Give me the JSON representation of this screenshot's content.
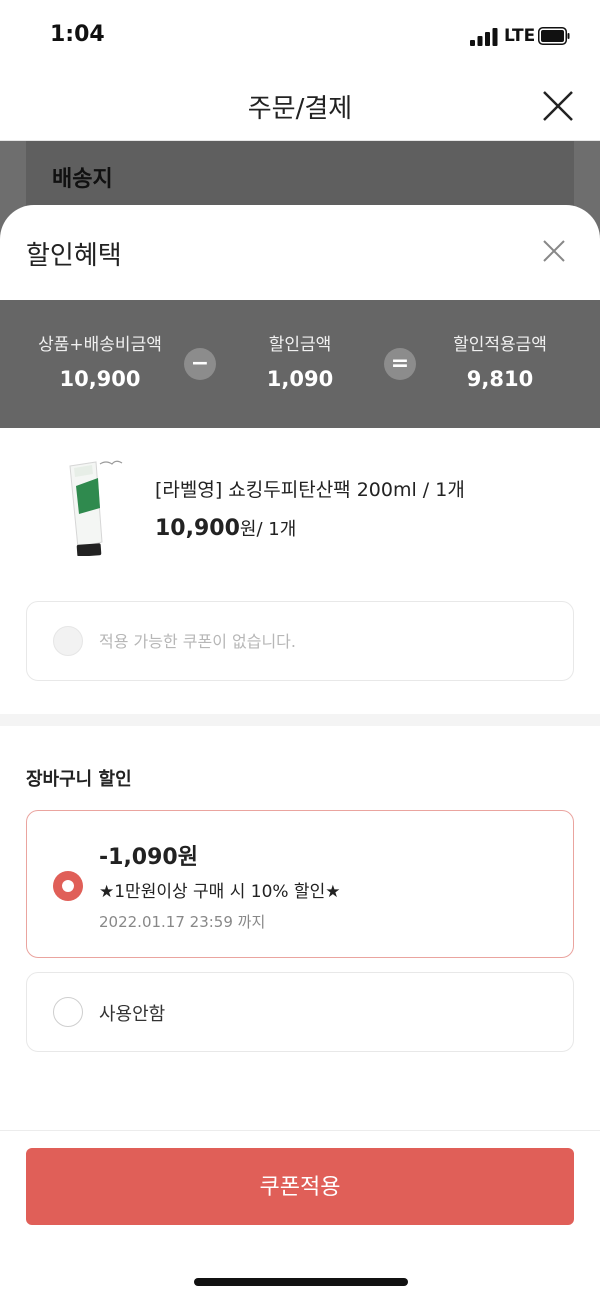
{
  "status_bar": {
    "time": "1:04",
    "network": "LTE",
    "icons": [
      "signal-bars-icon",
      "battery-icon"
    ]
  },
  "header": {
    "title": "주문/결제",
    "close_icon": "close-icon"
  },
  "background": {
    "shipping_title": "배송지"
  },
  "sheet": {
    "title": "할인혜택",
    "close_icon": "close-icon",
    "summary": {
      "product_shipping_label": "상품+배송비금액",
      "product_shipping_value": "10,900",
      "minus_symbol": "−",
      "discount_label": "할인금액",
      "discount_value": "1,090",
      "equals_symbol": "=",
      "final_label": "할인적용금액",
      "final_value": "9,810"
    },
    "product": {
      "name": "[라벨영] 쇼킹두피탄산팩 200ml / 1개",
      "price": "10,900",
      "price_unit": "원/ 1개"
    },
    "coupon": {
      "empty_text": "적용 가능한 쿠폰이 없습니다."
    },
    "cart_discount": {
      "title": "장바구니 할인",
      "options": [
        {
          "amount": "-1,090원",
          "description": "★1만원이상 구매 시 10% 할인★",
          "until": "2022.01.17 23:59 까지",
          "selected": true
        },
        {
          "label": "사용안함",
          "selected": false
        }
      ]
    },
    "apply_button": "쿠폰적용"
  },
  "colors": {
    "accent": "#e05f58",
    "summary_bg": "#666666",
    "dim_overlay": "#6e6e6e",
    "selected_border": "#eaa49f"
  }
}
